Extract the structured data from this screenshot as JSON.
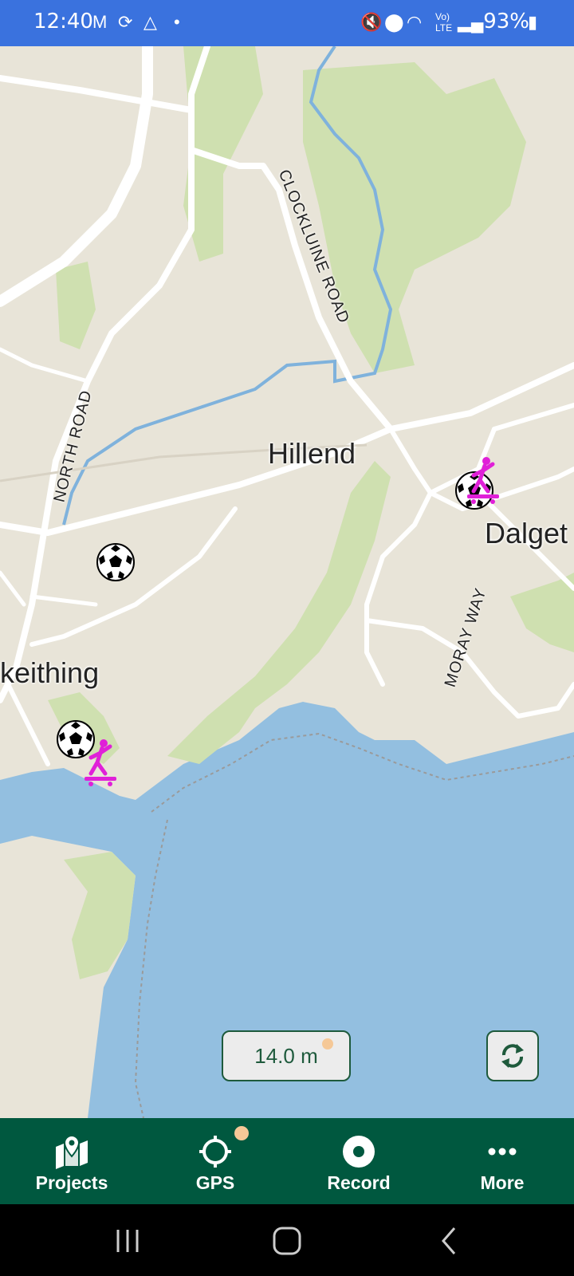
{
  "status_bar": {
    "time": "12:40",
    "battery": "93%",
    "icons": [
      "gmail-icon",
      "sync-icon",
      "drive-icon",
      "dot-icon",
      "mute-icon",
      "location-icon",
      "wifi-icon",
      "volte-icon",
      "signal-icon",
      "battery-icon"
    ]
  },
  "map": {
    "places": [
      "Hillend",
      "Dalget",
      "keithing"
    ],
    "roads": [
      "CLOCKLUINE ROAD",
      "NORTH ROAD",
      "MORAY WAY"
    ],
    "colors": {
      "land": "#e8e4d8",
      "water": "#93bfe0",
      "green": "#cfe0b0",
      "road": "#ffffff",
      "river": "#7fb2dc"
    },
    "markers": [
      "football-marker",
      "football-marker",
      "football-marker",
      "skateboard-marker",
      "skateboard-marker"
    ]
  },
  "controls": {
    "scale": "14.0 m",
    "sync_icon": "sync-icon"
  },
  "nav": {
    "items": [
      {
        "label": "Projects",
        "icon": "map-pin-icon"
      },
      {
        "label": "GPS",
        "icon": "crosshair-icon"
      },
      {
        "label": "Record",
        "icon": "record-icon"
      },
      {
        "label": "More",
        "icon": "more-dots-icon"
      }
    ],
    "accent": "#00583f",
    "badge_color": "#f5c897"
  }
}
